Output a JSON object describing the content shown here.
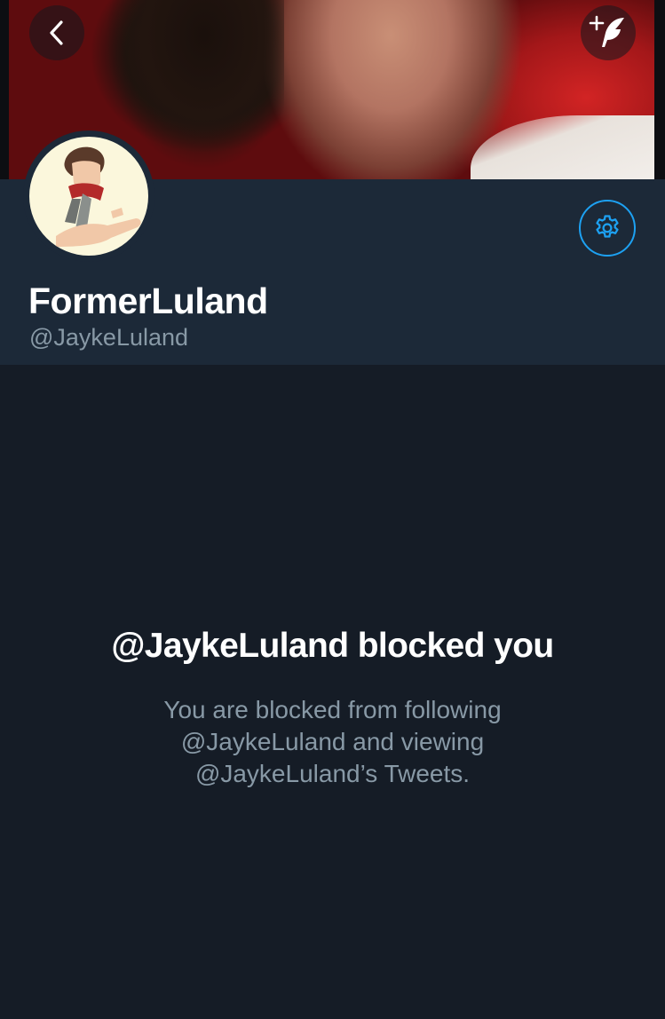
{
  "header": {
    "back_icon": "chevron-left-icon",
    "compose_icon": "compose-tweet-icon"
  },
  "profile": {
    "display_name": "FormerLuland",
    "handle": "@JaykeLuland",
    "settings_icon": "gear-icon"
  },
  "blocked": {
    "title": "@JaykeLuland blocked you",
    "body_lines": [
      "You are blocked from following",
      "@JaykeLuland and viewing",
      "@JaykeLuland’s Tweets."
    ]
  },
  "colors": {
    "background": "#151c26",
    "header_band": "#1c2938",
    "accent": "#1da1f2",
    "secondary_text": "#8899a6",
    "primary_text": "#ffffff"
  }
}
